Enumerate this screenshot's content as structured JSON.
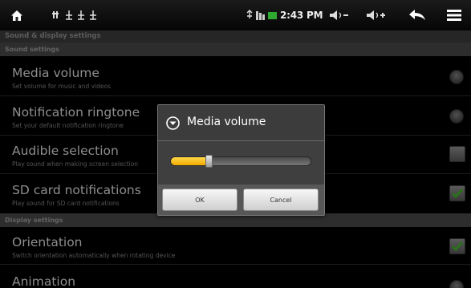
{
  "status_bar": {
    "time": "2:43 PM",
    "icons": [
      "home-icon",
      "usb-debug-icon",
      "usb-icon",
      "usb-icon",
      "usb-connected-icon",
      "signal-icon",
      "battery-icon",
      "volume-down-icon",
      "volume-up-icon",
      "back-icon",
      "menu-icon"
    ]
  },
  "screen_title": "Sound & display settings",
  "sections": {
    "sound": "Sound settings",
    "display": "Display settings"
  },
  "settings": {
    "media_volume": {
      "title": "Media volume",
      "summary": "Set volume for music and videos"
    },
    "notification_ringtone": {
      "title": "Notification ringtone",
      "summary": "Set your default notification ringtone"
    },
    "audible_selection": {
      "title": "Audible selection",
      "summary": "Play sound when making screen selection",
      "checked": false
    },
    "sd_card_notifications": {
      "title": "SD card notifications",
      "summary": "Play sound for SD card notifications",
      "checked": true
    },
    "orientation": {
      "title": "Orientation",
      "summary": "Switch orientation automatically when rotating device",
      "checked": true
    },
    "animation": {
      "title": "Animation"
    }
  },
  "dialog": {
    "title": "Media volume",
    "volume_level": 0.27,
    "ok_label": "OK",
    "cancel_label": "Cancel"
  },
  "colors": {
    "accent": "#f2a900",
    "check_green": "#3fae2a"
  }
}
